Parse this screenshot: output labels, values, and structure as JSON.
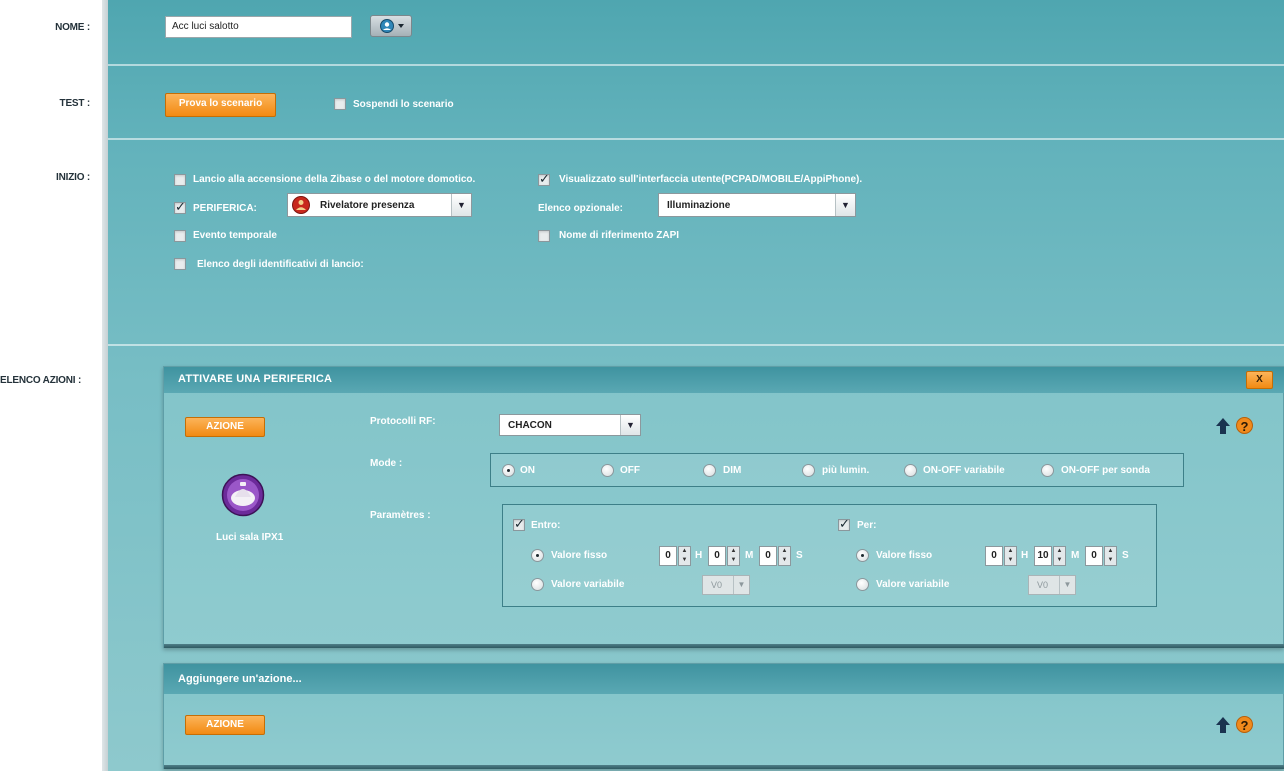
{
  "labels": {
    "nome": "NOME :",
    "test": "TEST :",
    "inizio": "INIZIO :",
    "elenco_azioni": "ELENCO AZIONI :"
  },
  "nome": {
    "value": "Acc luci salotto",
    "user_icon": "user-icon"
  },
  "test": {
    "try_button": "Prova lo scenario",
    "suspend_label": "Sospendi lo scenario",
    "suspend_checked": false
  },
  "inizio": {
    "launch_on_start": {
      "label": "Lancio alla accensione della Zibase o del motore domotico.",
      "checked": false
    },
    "periferica": {
      "label": "PERIFERICA:",
      "checked": true,
      "device": "Rivelatore presenza"
    },
    "evento_temporale": {
      "label": "Evento temporale",
      "checked": false
    },
    "elenco_identificativi": {
      "label": "Elenco degli identificativi di lancio:",
      "checked": false
    },
    "visualizzato": {
      "label": "Visualizzato sull'interfaccia utente(PCPAD/MOBILE/AppiPhone).",
      "checked": true
    },
    "elenco_opzionale": {
      "label": "Elenco opzionale:",
      "value": "Illuminazione"
    },
    "nome_zapi": {
      "label": "Nome di riferimento ZAPI",
      "checked": false
    }
  },
  "action_panel": {
    "title": "ATTIVARE UNA PERIFERICA",
    "close_label": "X",
    "action_button": "AZIONE",
    "device_name": "Luci sala IPX1",
    "protocol_label": "Protocolli RF:",
    "protocol_value": "CHACON",
    "mode_label": "Mode :",
    "modes": [
      "ON",
      "OFF",
      "DIM",
      "più lumin.",
      "ON-OFF variabile",
      "ON-OFF per sonda"
    ],
    "mode_selected": "ON",
    "params_label": "Paramètres :",
    "entro": {
      "label": "Entro:",
      "checked": true,
      "fixed_label": "Valore fisso",
      "variable_label": "Valore variabile",
      "h": "0",
      "m": "0",
      "s": "0",
      "var_value": "V0"
    },
    "per": {
      "label": "Per:",
      "checked": true,
      "fixed_label": "Valore fisso",
      "variable_label": "Valore variabile",
      "h": "0",
      "m": "10",
      "s": "0",
      "var_value": "V0"
    },
    "units": {
      "h": "H",
      "m": "M",
      "s": "S"
    },
    "help": "?"
  },
  "add_panel": {
    "title": "Aggiungere un'azione...",
    "action_button": "AZIONE",
    "help": "?"
  },
  "colors": {
    "accent_orange": "#f28a12",
    "panel_teal": "#5aa8b3"
  }
}
